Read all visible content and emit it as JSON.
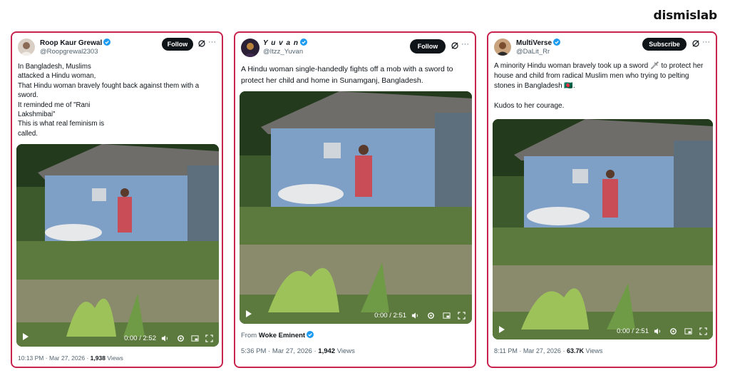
{
  "brand": {
    "name": "dismislab"
  },
  "tweets": [
    {
      "name": "Roop Kaur Grewal",
      "handle": "@Roopgrewal2303",
      "action": "Follow",
      "text": "In Bangladesh, Muslims\nattacked a Hindu woman,\nThat Hindu woman bravely fought back against them with a sword.\nIt reminded me of \"Rani\nLakshmibai\"\nThis is what real feminism is\ncalled.",
      "video_time": "0:00 / 2:52",
      "time": "10:13 PM",
      "date": "Mar 27, 2026",
      "views": "1,938",
      "views_label": "Views"
    },
    {
      "name": "Y u v a n",
      "handle": "@Itzz_Yuvan",
      "action": "Follow",
      "text": "A Hindu woman single-handedly fights off a mob with a sword to protect her child and home in Sunamganj, Bangladesh.",
      "video_time": "0:00 / 2:51",
      "from_label": "From",
      "from_name": "Woke Eminent",
      "time": "5:36 PM",
      "date": "Mar 27, 2026",
      "views": "1,942",
      "views_label": "Views"
    },
    {
      "name": "MultiVerse",
      "handle": "@DaLit_Rr",
      "action": "Subscribe",
      "text": "A minority Hindu woman bravely took up a sword 🗡 to protect her house and child from radical Muslim men who trying to pelting stones in Bangladesh 🇧🇩.\n\nKudos to her courage.",
      "video_time": "0:00 / 2:51",
      "time": "8:11 PM",
      "date": "Mar 27, 2026",
      "views": "63.7K",
      "views_label": "Views"
    }
  ],
  "separator": "·",
  "more_glyph": "···",
  "icons": [
    "verified-badge-icon",
    "grok-icon",
    "more-icon",
    "play-icon",
    "volume-icon",
    "settings-icon",
    "picture-in-picture-icon",
    "fullscreen-icon"
  ],
  "colors": {
    "card_border": "#c8234d",
    "verified": "#1d9bf0",
    "button": "#0f1419",
    "muted": "#536471"
  }
}
